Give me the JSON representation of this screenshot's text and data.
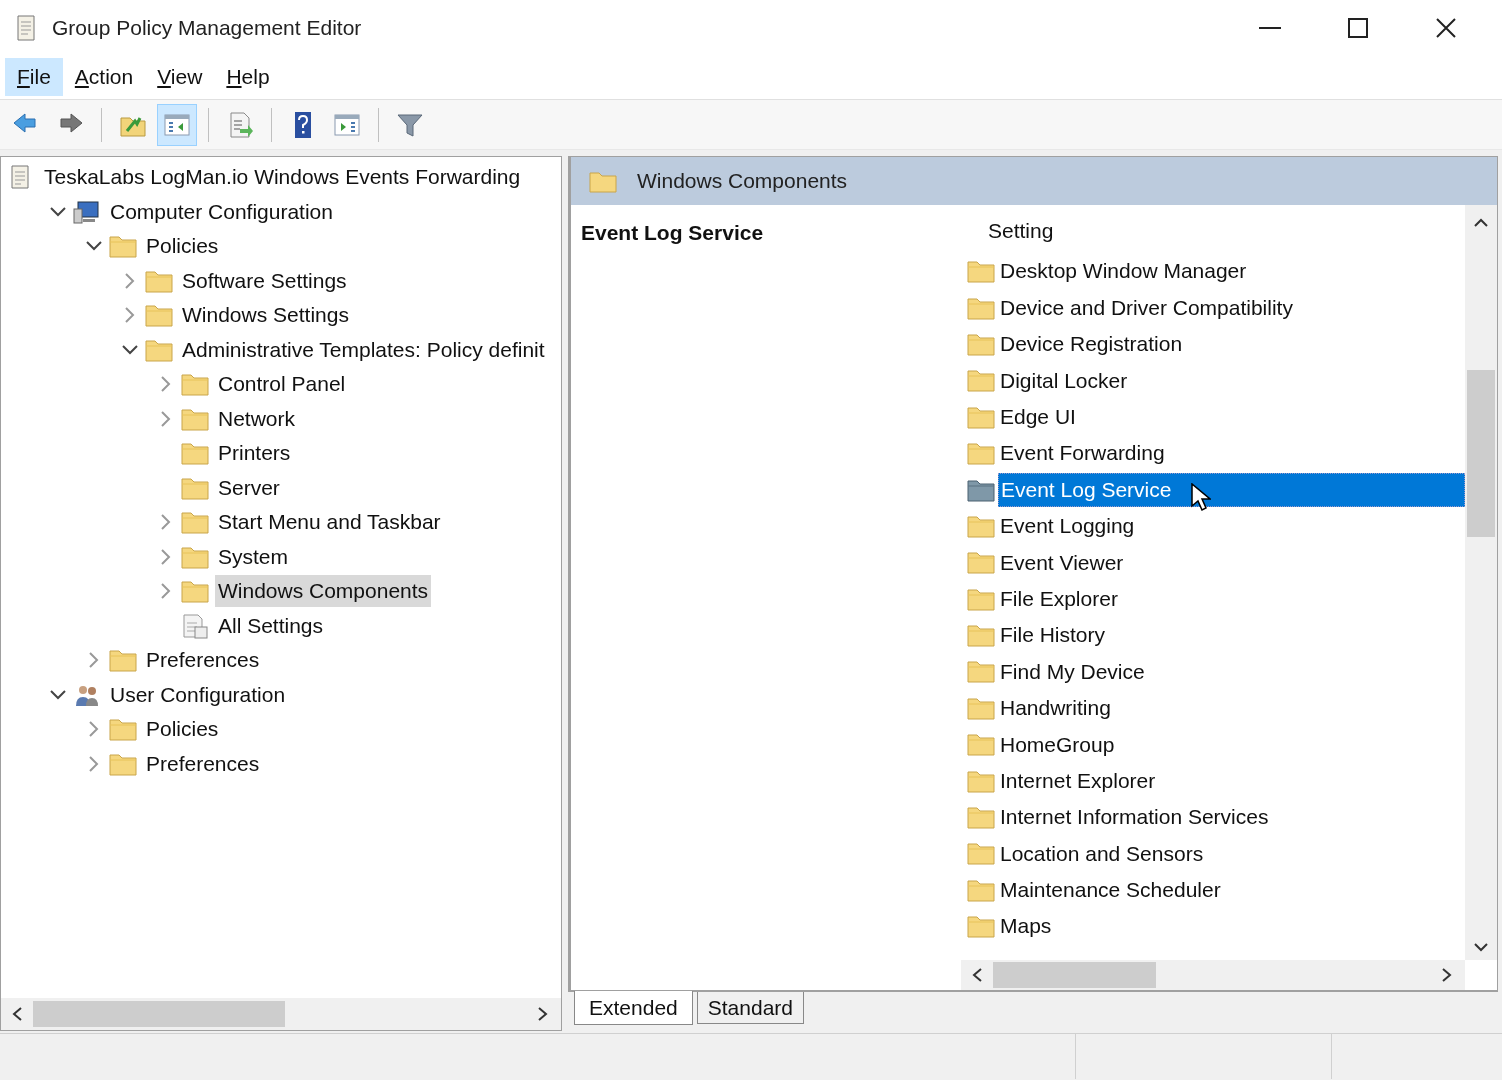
{
  "window": {
    "title": "Group Policy Management Editor"
  },
  "menu": [
    {
      "label": "File",
      "selected": true
    },
    {
      "label": "Action",
      "selected": false
    },
    {
      "label": "View",
      "selected": false
    },
    {
      "label": "Help",
      "selected": false
    }
  ],
  "toolbar": [
    {
      "kind": "back",
      "pressed": false
    },
    {
      "kind": "forward",
      "pressed": false
    },
    {
      "kind": "sep"
    },
    {
      "kind": "up",
      "pressed": false
    },
    {
      "kind": "tree",
      "pressed": true
    },
    {
      "kind": "sep"
    },
    {
      "kind": "export",
      "pressed": false
    },
    {
      "kind": "sep"
    },
    {
      "kind": "help",
      "pressed": false
    },
    {
      "kind": "pane",
      "pressed": false
    },
    {
      "kind": "sep"
    },
    {
      "kind": "filter",
      "pressed": false
    }
  ],
  "tree": [
    {
      "label": "TeskaLabs LogMan.io Windows Events Forwarding",
      "kind": "doc",
      "selected": false,
      "children": [
        {
          "label": "Computer Configuration",
          "kind": "computer",
          "expanded": true,
          "selected": false,
          "children": [
            {
              "label": "Policies",
              "kind": "folder",
              "expanded": true,
              "selected": false,
              "children": [
                {
                  "label": "Software Settings",
                  "kind": "folder",
                  "expanded": false,
                  "selected": false
                },
                {
                  "label": "Windows Settings",
                  "kind": "folder",
                  "expanded": false,
                  "selected": false
                },
                {
                  "label": "Administrative Templates: Policy definit",
                  "kind": "folder",
                  "expanded": true,
                  "selected": false,
                  "children": [
                    {
                      "label": "Control Panel",
                      "kind": "folder",
                      "expanded": false,
                      "selected": false
                    },
                    {
                      "label": "Network",
                      "kind": "folder",
                      "expanded": false,
                      "selected": false
                    },
                    {
                      "label": "Printers",
                      "kind": "folder",
                      "selected": false
                    },
                    {
                      "label": "Server",
                      "kind": "folder",
                      "selected": false
                    },
                    {
                      "label": "Start Menu and Taskbar",
                      "kind": "folder",
                      "expanded": false,
                      "selected": false
                    },
                    {
                      "label": "System",
                      "kind": "folder",
                      "expanded": false,
                      "selected": false
                    },
                    {
                      "label": "Windows Components",
                      "kind": "folder",
                      "expanded": false,
                      "selected": true
                    },
                    {
                      "label": "All Settings",
                      "kind": "settings",
                      "selected": false
                    }
                  ]
                }
              ]
            },
            {
              "label": "Preferences",
              "kind": "folder",
              "expanded": false,
              "selected": false
            }
          ]
        },
        {
          "label": "User Configuration",
          "kind": "user",
          "expanded": true,
          "selected": false,
          "children": [
            {
              "label": "Policies",
              "kind": "folder",
              "expanded": false,
              "selected": false
            },
            {
              "label": "Preferences",
              "kind": "folder",
              "expanded": false,
              "selected": false
            }
          ]
        }
      ]
    }
  ],
  "details": {
    "header": "Windows Components",
    "item_title": "Event Log Service",
    "column": "Setting",
    "items": [
      {
        "label": "Desktop Window Manager",
        "kind": "folder",
        "selected": false
      },
      {
        "label": "Device and Driver Compatibility",
        "kind": "folder",
        "selected": false
      },
      {
        "label": "Device Registration",
        "kind": "folder",
        "selected": false
      },
      {
        "label": "Digital Locker",
        "kind": "folder",
        "selected": false
      },
      {
        "label": "Edge UI",
        "kind": "folder",
        "selected": false
      },
      {
        "label": "Event Forwarding",
        "kind": "folder",
        "selected": false
      },
      {
        "label": "Event Log Service",
        "kind": "folder-open",
        "selected": true
      },
      {
        "label": "Event Logging",
        "kind": "folder",
        "selected": false
      },
      {
        "label": "Event Viewer",
        "kind": "folder",
        "selected": false
      },
      {
        "label": "File Explorer",
        "kind": "folder",
        "selected": false
      },
      {
        "label": "File History",
        "kind": "folder",
        "selected": false
      },
      {
        "label": "Find My Device",
        "kind": "folder",
        "selected": false
      },
      {
        "label": "Handwriting",
        "kind": "folder",
        "selected": false
      },
      {
        "label": "HomeGroup",
        "kind": "folder",
        "selected": false
      },
      {
        "label": "Internet Explorer",
        "kind": "folder",
        "selected": false
      },
      {
        "label": "Internet Information Services",
        "kind": "folder",
        "selected": false
      },
      {
        "label": "Location and Sensors",
        "kind": "folder",
        "selected": false
      },
      {
        "label": "Maintenance Scheduler",
        "kind": "folder",
        "selected": false
      },
      {
        "label": "Maps",
        "kind": "folder",
        "selected": false
      }
    ]
  },
  "tabs": [
    {
      "label": "Extended",
      "selected": true
    },
    {
      "label": "Standard",
      "selected": false
    }
  ]
}
